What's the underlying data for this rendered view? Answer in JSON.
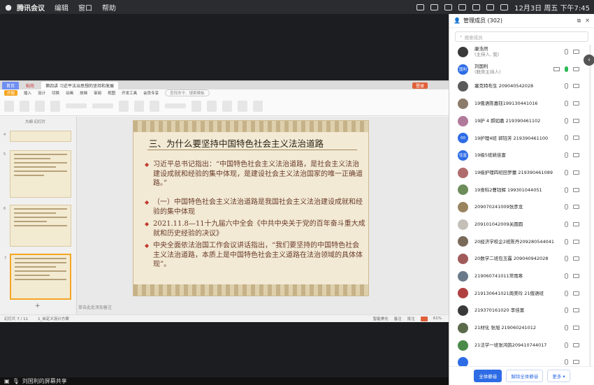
{
  "menubar": {
    "app": "腾讯会议",
    "items": [
      "编辑",
      "窗口",
      "帮助"
    ],
    "clock": "12月3日 周五 下午7:45"
  },
  "wps": {
    "tabs": {
      "home": "首页",
      "wps": "稻壳",
      "doc": "第四讲 习近平法治思想的坚持和发展",
      "login": "登录"
    },
    "ribbon_tabs": [
      "开始",
      "插入",
      "设计",
      "切换",
      "动画",
      "放映",
      "审阅",
      "视图",
      "开发工具",
      "会员专享"
    ],
    "search": "查找命令、搜索模板",
    "thumbs_header": "大纲  幻灯片",
    "thumb_numbers": [
      "4",
      "5",
      "6",
      "7"
    ],
    "notes_hint": "单击此处添加备注",
    "status_left": "幻灯片 7 / 11",
    "status_theme": "1_自定义设计方案",
    "status_right": [
      "智能美化",
      "备注",
      "批注"
    ],
    "zoom": "61%"
  },
  "slide": {
    "title": "三、为什么要坚持中国特色社会主义法治道路",
    "bullets": [
      "习近平总书记指出：“中国特色社会主义法治道路，是社会主义法治建设成就和经验的集中体现，是建设社会主义法治国家的唯一正确道路。”",
      "（一）中国特色社会主义法治道路是我国社会主义法治建设成就和经验的集中体现",
      "2021.11.8—11十九届六中全会《中共中央关于党的百年奋斗重大成就和历史经验的决议》",
      "中央全面依法治国工作会议讲话指出，“我们要坚持的中国特色社会主义法治道路，本质上是中国特色社会主义道路在法治领域的具体体现”。"
    ]
  },
  "share_bar": "刘国利的屏幕共享",
  "panel": {
    "title": "管理成员 (302)",
    "search_placeholder": "搜索成员",
    "members": [
      {
        "name": "康浩然",
        "role": "(主持人, 我)",
        "avatar": "",
        "color": "#3a3a3a"
      },
      {
        "name": "刘国利",
        "role": "(联席主持人)",
        "avatar": "国利",
        "color": "#2e6ce6"
      },
      {
        "name": "塞克特布生  209040542028",
        "role": "",
        "avatar": "",
        "color": "#5a5a5a"
      },
      {
        "name": "19俄语陈嘉钰199130441016",
        "role": "",
        "avatar": "",
        "color": "#8c7a6b"
      },
      {
        "name": "19护 4 郝如嘉 219390461102",
        "role": "",
        "avatar": "",
        "color": "#b07a9a"
      },
      {
        "name": "19护理4班  郭钰芳 219390461100",
        "role": "",
        "avatar": "00",
        "color": "#2e6ce6"
      },
      {
        "name": "19级5班姚佳富",
        "role": "",
        "avatar": "佳富",
        "color": "#2e6ce6"
      },
      {
        "name": "19级护理四班田罗蕾 219390461089",
        "role": "",
        "avatar": "",
        "color": "#b06c6c"
      },
      {
        "name": "19食科2曹钰辉 199301044051",
        "role": "",
        "avatar": "",
        "color": "#6c8c5a"
      },
      {
        "name": "209070241009张彦龙",
        "role": "",
        "avatar": "",
        "color": "#9a8460"
      },
      {
        "name": "209101042009关圆圆",
        "role": "",
        "avatar": "",
        "color": "#c4c0b8"
      },
      {
        "name": "20经济学校企2班陈丹209280544041",
        "role": "",
        "avatar": "",
        "color": "#7a6a5a"
      },
      {
        "name": "20数学二班包玉露 209040942028",
        "role": "",
        "avatar": "",
        "color": "#a05a5a"
      },
      {
        "name": "219060741011常雨寒",
        "role": "",
        "avatar": "",
        "color": "#6a7a8a"
      },
      {
        "name": "219130641021周美玲 21俄语班",
        "role": "",
        "avatar": "",
        "color": "#b04040"
      },
      {
        "name": "219370161020 李佳富",
        "role": "",
        "avatar": "",
        "color": "#3a3a3a"
      },
      {
        "name": "21材化 张旭 219060241012",
        "role": "",
        "avatar": "",
        "color": "#5a6a4a"
      },
      {
        "name": "21法学一班张鸿鹄209410744017",
        "role": "",
        "avatar": "",
        "color": "#4a8a4a"
      },
      {
        "name": "",
        "role": "",
        "avatar": "",
        "color": "#2e6ce6"
      }
    ],
    "buttons": {
      "mute_all": "全体静音",
      "unmute_all": "解除全体静音",
      "more": "更多 ▾"
    }
  }
}
